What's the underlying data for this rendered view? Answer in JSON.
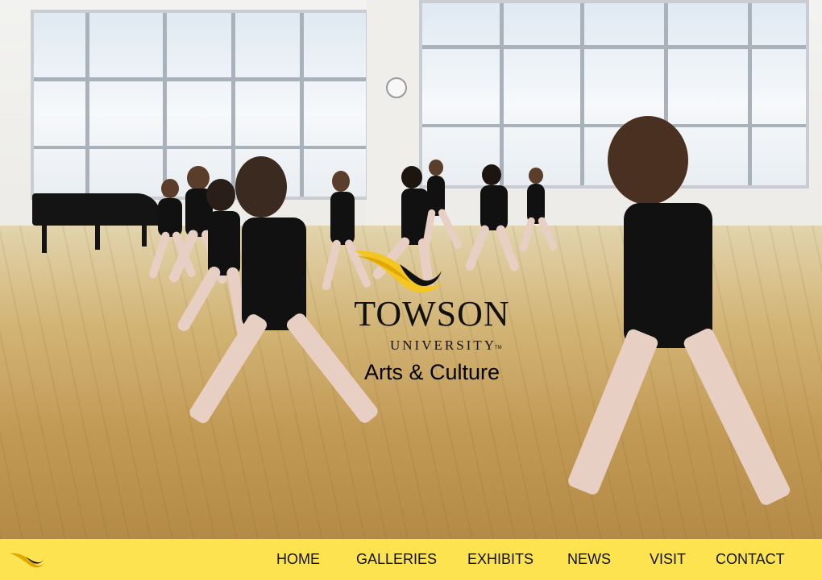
{
  "hero": {
    "logo": {
      "title": "TOWSON",
      "subtitle": "UNIVERSITY",
      "trademark": "TM",
      "caption": "Arts & Culture"
    }
  },
  "nav": {
    "items": [
      {
        "label": "HOME"
      },
      {
        "label": "GALLERIES"
      },
      {
        "label": "EXHIBITS"
      },
      {
        "label": "NEWS"
      },
      {
        "label": "VISIT"
      },
      {
        "label": "CONTACT"
      }
    ]
  },
  "colors": {
    "navbar_background": "#fde34f",
    "logo_gold": "#f3c623",
    "text": "#111111"
  },
  "icons": {
    "nav_logo": "towson-swoosh-icon",
    "hero_logo_mark": "towson-swoosh-icon"
  }
}
